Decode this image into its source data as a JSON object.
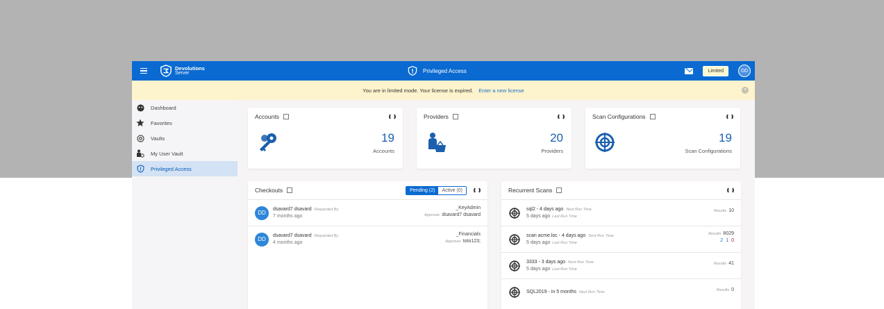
{
  "topbar": {
    "logo_line1": "Devolutions",
    "logo_line2": "Server",
    "title": "Privileged Access",
    "limited_label": "Limited",
    "avatar": "DD",
    "colors": {
      "bar": "#0a6ad1"
    }
  },
  "banner": {
    "message": "You are in limited mode. Your license is expired.",
    "link": "Enter a new license"
  },
  "sidebar": {
    "items": [
      {
        "label": "Dashboard",
        "icon": "dashboard-icon"
      },
      {
        "label": "Favorites",
        "icon": "star-icon"
      },
      {
        "label": "Vaults",
        "icon": "vault-icon"
      },
      {
        "label": "My User Vault",
        "icon": "user-vault-icon"
      },
      {
        "label": "Privileged Access",
        "icon": "shield-icon",
        "active": true
      }
    ]
  },
  "stats": [
    {
      "title": "Accounts",
      "value": "19",
      "label": "Accounts",
      "icon": "key-icon"
    },
    {
      "title": "Providers",
      "value": "20",
      "label": "Providers",
      "icon": "provider-icon"
    },
    {
      "title": "Scan Configurations",
      "value": "19",
      "label": "Scan Configurations",
      "icon": "target-icon"
    }
  ],
  "checkouts": {
    "title": "Checkouts",
    "tab_pending": "Pending (2)",
    "tab_active": "Active (0)",
    "rows": [
      {
        "avatar": "DD",
        "user": "dsavard7 dsavard",
        "requested_by": "Requested By",
        "time": "7 months ago",
        "account": "_KeyAdmin",
        "approver_label": "Approver",
        "approver": "dsavard7 dsavard"
      },
      {
        "avatar": "DD",
        "user": "dsavard7 dsavard",
        "requested_by": "Requested By",
        "time": "4 months ago",
        "account": "_Financials",
        "approver_label": "Approver",
        "approver": "toto123;"
      }
    ]
  },
  "scans": {
    "title": "Recurrent Scans",
    "rows": [
      {
        "name": "sql2 - 4 days ago",
        "next_label": "Next Run Time",
        "last": "5 days ago",
        "last_label": "Last Run Time",
        "results_label": "Results",
        "results": "10"
      },
      {
        "name": "scan acme.loc - 4 days ago",
        "next_label": "Next Run Time",
        "last": "5 days ago",
        "last_label": "Last Run Time",
        "results_label": "Results",
        "results": "8029",
        "c1": "2",
        "c2": "1",
        "c3": "0"
      },
      {
        "name": "3333 - 3 days ago",
        "next_label": "Next Run Time",
        "last": "5 days ago",
        "last_label": "Last Run Time",
        "results_label": "Results",
        "results": "41"
      },
      {
        "name": "SQL2019 - in 5 months",
        "next_label": "Next Run Time",
        "last": "",
        "last_label": "",
        "results_label": "Results",
        "results": "0"
      }
    ]
  }
}
